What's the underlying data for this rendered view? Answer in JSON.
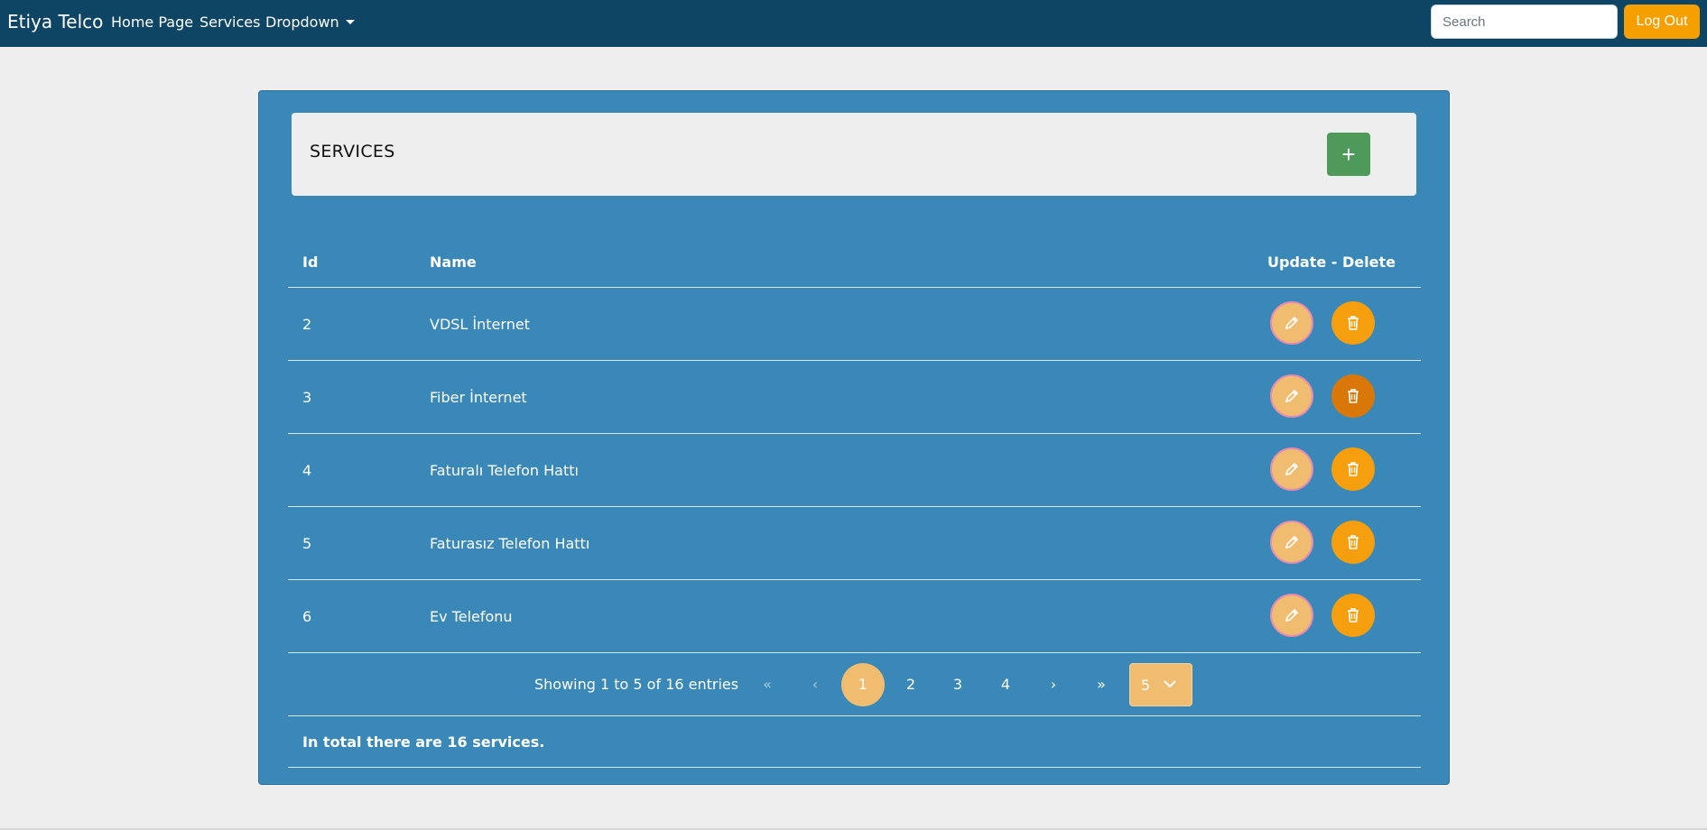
{
  "navbar": {
    "brand": "Etiya Telco",
    "links": [
      "Home Page",
      "Services",
      "Dropdown"
    ],
    "search_placeholder": "Search",
    "logout_label": "Log Out"
  },
  "panel": {
    "title": "SERVICES",
    "add_label": "+"
  },
  "table": {
    "headers": [
      "Id",
      "Name",
      "Update - Delete"
    ],
    "rows": [
      {
        "id": "2",
        "name": "VDSL İnternet"
      },
      {
        "id": "3",
        "name": "Fiber İnternet"
      },
      {
        "id": "4",
        "name": "Faturalı Telefon Hattı"
      },
      {
        "id": "5",
        "name": "Faturasız Telefon Hattı"
      },
      {
        "id": "6",
        "name": "Ev Telefonu"
      }
    ]
  },
  "pagination": {
    "summary": "Showing 1 to 5 of 16 entries",
    "first": "«",
    "prev": "‹",
    "pages": [
      "1",
      "2",
      "3",
      "4"
    ],
    "next": "›",
    "last": "»",
    "page_size": "5"
  },
  "footer": {
    "total_text": "In total there are 16 services."
  },
  "colors": {
    "navbar": "#0f4564",
    "panel": "#3a88b8",
    "accent": "#f59f00",
    "add_button": "#4e9a5a",
    "edit_button": "#f0bd70"
  }
}
